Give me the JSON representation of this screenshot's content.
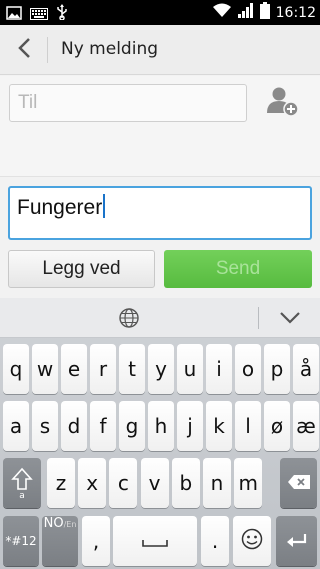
{
  "status_bar": {
    "time": "16:12",
    "icons": [
      "picture-icon",
      "keyboard-icon",
      "usb-icon",
      "wifi-icon",
      "signal-icon",
      "battery-icon"
    ]
  },
  "header": {
    "title": "Ny melding"
  },
  "recipient": {
    "placeholder": "Til"
  },
  "compose": {
    "message_text": "Fungerer",
    "attach_label": "Legg ved",
    "send_label": "Send"
  },
  "keyboard": {
    "row1": [
      "q",
      "w",
      "e",
      "r",
      "t",
      "y",
      "u",
      "i",
      "o",
      "p",
      "å"
    ],
    "row2": [
      "a",
      "s",
      "d",
      "f",
      "g",
      "h",
      "j",
      "k",
      "l",
      "ø",
      "æ"
    ],
    "row3": [
      "z",
      "x",
      "c",
      "v",
      "b",
      "n",
      "m"
    ],
    "symbols_label": "*#12",
    "language_label": "NO",
    "language_alt": "En",
    "comma_label": ",",
    "period_label": ".",
    "shift_sub_label": "a"
  },
  "colors": {
    "accent": "#4aa3df",
    "send_green": "#5fc147",
    "status_bar_bg": "#000000"
  }
}
